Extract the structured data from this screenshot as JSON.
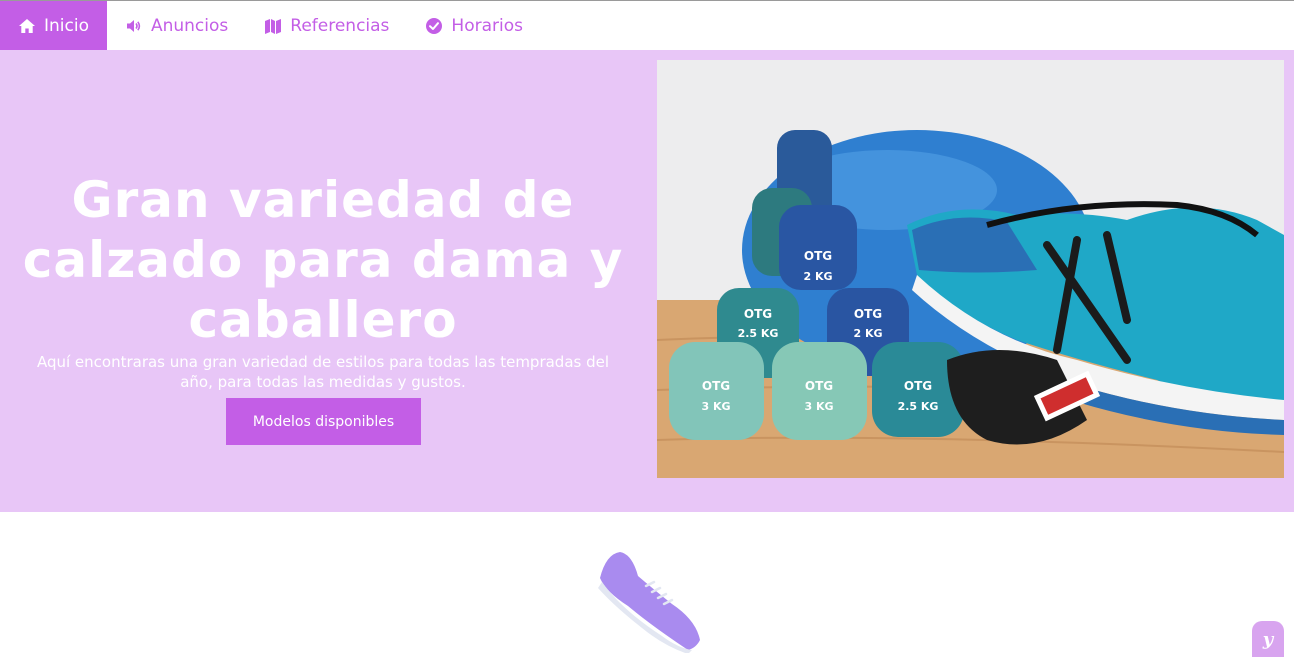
{
  "nav": {
    "items": [
      {
        "label": "Inicio",
        "icon": "home-icon",
        "active": true
      },
      {
        "label": "Anuncios",
        "icon": "megaphone-icon",
        "active": false
      },
      {
        "label": "Referencias",
        "icon": "map-icon",
        "active": false
      },
      {
        "label": "Horarios",
        "icon": "check-circle-icon",
        "active": false
      }
    ]
  },
  "hero": {
    "title": "Gran variedad de calzado para dama y caballero",
    "subtitle": "Aquí encontraras una gran variedad de estilos para todas las tempradas del año, para todas las medidas y gustos.",
    "button_label": "Modelos disponibles",
    "image": {
      "dumbbell_labels": [
        "2 KG",
        "2.5 KG",
        "2 KG",
        "3 KG",
        "3 KG",
        "2.5 KG"
      ],
      "brand": "OTG"
    }
  },
  "footer_badge": {
    "label": "y"
  },
  "colors": {
    "accent": "#c35ee6",
    "hero_bg": "#e8c6f7",
    "shoe": "#a98bef"
  }
}
